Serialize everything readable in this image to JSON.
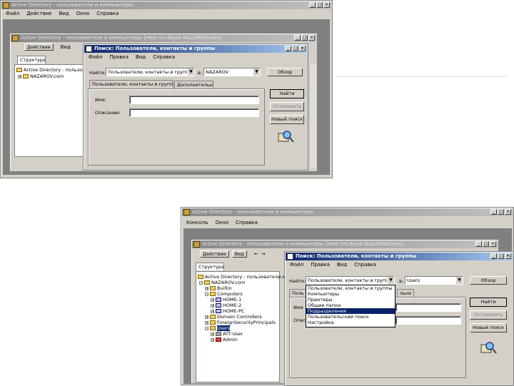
{
  "w1": {
    "title": "Active Directory - пользователи и компьютеры",
    "menu": [
      "Файл",
      "Действие",
      "Вид",
      "Окно",
      "Справка"
    ]
  },
  "w2": {
    "title": "Active Directory - пользователи и компьютеры [Host-Srv.Biysk.NAZAROV.com]",
    "menu": [
      "Действие",
      "Вид"
    ],
    "tab_label": "Структура",
    "tree": [
      "Active Directory - пользователи и компьютеры",
      "NAZAROV.com"
    ]
  },
  "d1": {
    "title": "Поиск: Пользователи, контакты и группы",
    "menu": [
      "Файл",
      "Правка",
      "Вид",
      "Справка"
    ],
    "find_label": "Найти:",
    "find_value": "Пользователи, контакты и группы",
    "in_label": "в:",
    "in_value": "NAZAROV",
    "browse_btn": "Обзор",
    "tabs": [
      "Пользователи, контакты и группы",
      "Дополнительно"
    ],
    "name_label": "Имя:",
    "desc_label": "Описание:",
    "btn_find": "Найти",
    "btn_stop": "Остановить",
    "btn_clear": "Новый поиск"
  },
  "w3": {
    "title": "Active Directory - пользователи и компьютеры",
    "menu": [
      "Консоль",
      "Окно",
      "Справка"
    ]
  },
  "w4": {
    "title": "Active Directory - пользователи и компьютеры [Host-Srv.Biysk.NAZAROV.com]",
    "menu": [
      "Действие",
      "Вид"
    ],
    "tab_label": "Структура",
    "tree": [
      "Active Directory - пользователи и компьютеры",
      "NAZAROV.com",
      "Builtin",
      "Computers",
      "HOME-1",
      "HOME-2",
      "HOME-PC",
      "Domain Controllers",
      "ForeignSecurityPrincipals",
      "Users",
      "ATT-User",
      "Admin"
    ]
  },
  "d2": {
    "title": "Поиск: Пользователи, контакты и группы",
    "menu": [
      "Файл",
      "Правка",
      "Вид",
      "Справка"
    ],
    "find_label": "Найти:",
    "find_value": "Пользователи, контакты и группы",
    "in_label": "в:",
    "in_value": "Users",
    "browse_btn": "Обзор",
    "dropdown": [
      "Пользователи, контакты и группы",
      "Компьютеры",
      "Принтеры",
      "Общие папки",
      "Подразделения",
      "Пользовательский поиск",
      "Настройка"
    ],
    "tab_a": "Поль",
    "tab_b": "льно",
    "name_label": "Имя",
    "desc_label": "Опис",
    "btn_find": "Найти",
    "btn_stop": "Остановить",
    "btn_clear": "Новый поиск"
  },
  "colors": {
    "active_caption": "#0a246a",
    "inactive_caption": "#8a8a8a",
    "face": "#d4d0c8",
    "selection": "#0a246a"
  }
}
